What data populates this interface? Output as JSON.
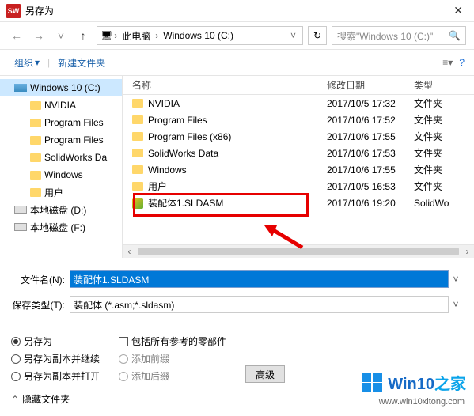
{
  "title": "另存为",
  "breadcrumb": {
    "pc": "此电脑",
    "drive": "Windows 10 (C:)"
  },
  "search": {
    "placeholder": "搜索\"Windows 10 (C:)\""
  },
  "toolbar": {
    "organize": "组织",
    "newfolder": "新建文件夹"
  },
  "tree": [
    {
      "label": "Windows 10 (C:)",
      "type": "disk",
      "indent": 0,
      "selected": true
    },
    {
      "label": "NVIDIA",
      "type": "folder",
      "indent": 1
    },
    {
      "label": "Program Files",
      "type": "folder",
      "indent": 1
    },
    {
      "label": "Program Files",
      "type": "folder",
      "indent": 1
    },
    {
      "label": "SolidWorks Da",
      "type": "folder",
      "indent": 1
    },
    {
      "label": "Windows",
      "type": "folder",
      "indent": 1
    },
    {
      "label": "用户",
      "type": "folder",
      "indent": 1
    },
    {
      "label": "本地磁盘 (D:)",
      "type": "drive",
      "indent": 0
    },
    {
      "label": "本地磁盘 (F:)",
      "type": "drive",
      "indent": 0
    }
  ],
  "cols": {
    "name": "名称",
    "date": "修改日期",
    "type": "类型"
  },
  "files": [
    {
      "name": "NVIDIA",
      "date": "2017/10/5 17:32",
      "type": "文件夹",
      "kind": "folder"
    },
    {
      "name": "Program Files",
      "date": "2017/10/6 17:52",
      "type": "文件夹",
      "kind": "folder"
    },
    {
      "name": "Program Files (x86)",
      "date": "2017/10/6 17:55",
      "type": "文件夹",
      "kind": "folder"
    },
    {
      "name": "SolidWorks Data",
      "date": "2017/10/6 17:53",
      "type": "文件夹",
      "kind": "folder"
    },
    {
      "name": "Windows",
      "date": "2017/10/6 17:55",
      "type": "文件夹",
      "kind": "folder"
    },
    {
      "name": "用户",
      "date": "2017/10/5 16:53",
      "type": "文件夹",
      "kind": "folder"
    },
    {
      "name": "装配体1.SLDASM",
      "date": "2017/10/6 19:20",
      "type": "SolidWo",
      "kind": "sw"
    }
  ],
  "filename_label": "文件名(N):",
  "filename_value": "装配体1.SLDASM",
  "filetype_label": "保存类型(T):",
  "filetype_value": "装配体 (*.asm;*.sldasm)",
  "opts": {
    "saveas": "另存为",
    "saveas_copy_continue": "另存为副本并继续",
    "saveas_copy_open": "另存为副本并打开",
    "include_refs": "包括所有参考的零部件",
    "add_prefix": "添加前缀",
    "add_suffix": "添加后缀",
    "advanced": "高级"
  },
  "hide_folders": "隐藏文件夹",
  "watermark": {
    "brand": "Win10",
    "suffix": "之家",
    "url": "www.win10xitong.com"
  }
}
